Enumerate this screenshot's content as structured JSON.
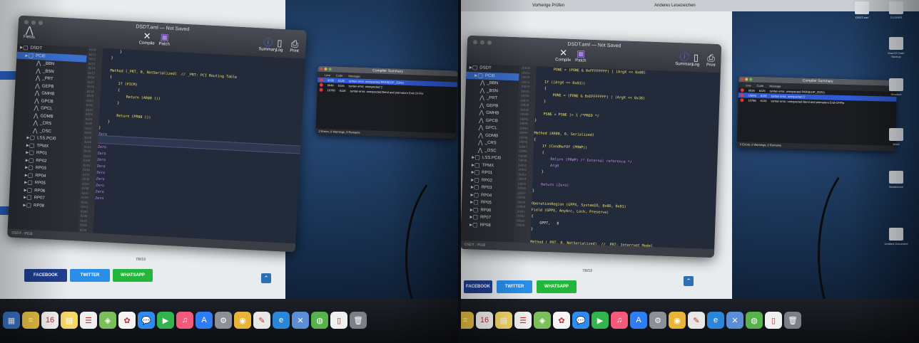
{
  "left_photo": {
    "window_title": "DSDT.aml — Not Saved",
    "toolbar": {
      "fields_label": "Fields",
      "compile_label": "Compile",
      "patch_label": "Patch",
      "summary_label": "Summary",
      "log_label": "Log",
      "print_label": "Print"
    },
    "tree": [
      {
        "label": "DSDT",
        "indent": 0,
        "icon": "folder-icon"
      },
      {
        "label": "PCI0",
        "indent": 1,
        "icon": "folder-icon",
        "selected": true
      },
      {
        "label": "_BBN",
        "indent": 3,
        "icon": "method-icon"
      },
      {
        "label": "_BSN",
        "indent": 3,
        "icon": "method-icon"
      },
      {
        "label": "_PRT",
        "indent": 3,
        "icon": "method-icon"
      },
      {
        "label": "GEPB",
        "indent": 3,
        "icon": "method-icon"
      },
      {
        "label": "GMHB",
        "indent": 3,
        "icon": "method-icon"
      },
      {
        "label": "GPCB",
        "indent": 3,
        "icon": "method-icon"
      },
      {
        "label": "GPCL",
        "indent": 3,
        "icon": "method-icon"
      },
      {
        "label": "GDMB",
        "indent": 3,
        "icon": "method-icon"
      },
      {
        "label": "_CRS",
        "indent": 3,
        "icon": "method-icon"
      },
      {
        "label": "_OSC",
        "indent": 3,
        "icon": "method-icon"
      },
      {
        "label": "LSS.PCI0",
        "indent": 2,
        "icon": "folder-icon"
      },
      {
        "label": "TPMX",
        "indent": 2,
        "icon": "folder-icon"
      },
      {
        "label": "RP01",
        "indent": 2,
        "icon": "folder-icon"
      },
      {
        "label": "RP02",
        "indent": 2,
        "icon": "folder-icon"
      },
      {
        "label": "RP03",
        "indent": 2,
        "icon": "folder-icon"
      },
      {
        "label": "RP04",
        "indent": 2,
        "icon": "folder-icon"
      },
      {
        "label": "RP05",
        "indent": 2,
        "icon": "folder-icon"
      },
      {
        "label": "RP06",
        "indent": 2,
        "icon": "folder-icon"
      },
      {
        "label": "RP07",
        "indent": 2,
        "icon": "folder-icon"
      },
      {
        "label": "RP08",
        "indent": 2,
        "icon": "folder-icon"
      }
    ],
    "gutter_numbers": [
      "6210",
      "6211",
      "6212",
      "6213",
      "6214",
      "6215",
      "6216",
      "6217",
      "6218",
      "6219",
      "6220",
      "6221",
      "6222",
      "6223",
      "6224",
      "6225",
      "6226",
      "6227",
      "6228",
      "6229",
      "6230",
      "6231",
      "6232",
      "6233",
      "6234",
      "6235",
      "6236",
      "6237",
      "6238",
      "6239",
      "6240",
      "6241",
      "6242",
      "6243",
      "6244",
      "6245",
      "6246",
      "6247",
      "6248",
      "6249",
      "6250"
    ],
    "code_lines": [
      {
        "text": "        }",
        "cls": ""
      },
      {
        "text": "    }",
        "cls": ""
      },
      {
        "text": "",
        "cls": ""
      },
      {
        "text": "    Method (_PRT, 0, NotSerialized)  // _PRT: PCI Routing Table",
        "cls": "kw"
      },
      {
        "text": "    {",
        "cls": ""
      },
      {
        "text": "        If (PICM)",
        "cls": "kw"
      },
      {
        "text": "        {",
        "cls": ""
      },
      {
        "text": "            Return (AR00 ())",
        "cls": "kw"
      },
      {
        "text": "        }",
        "cls": ""
      },
      {
        "text": "",
        "cls": ""
      },
      {
        "text": "        Return (PR00 ())",
        "cls": "kw"
      },
      {
        "text": "    }",
        "cls": ""
      },
      {
        "text": "}",
        "cls": ""
      },
      {
        "text": "Zero",
        "cls": "fn"
      },
      {
        "text": "Zero",
        "cls": "fn"
      },
      {
        "text": "Zero",
        "cls": "fn"
      },
      {
        "text": "Zero",
        "cls": "fn"
      },
      {
        "text": "Zero",
        "cls": "fn"
      },
      {
        "text": "Zero",
        "cls": "fn"
      },
      {
        "text": "Zero",
        "cls": "fn"
      },
      {
        "text": "Zero",
        "cls": "fn"
      },
      {
        "text": "Zero",
        "cls": "fn"
      },
      {
        "text": "Zero",
        "cls": "fn"
      },
      {
        "text": "Zero",
        "cls": "fn"
      }
    ],
    "status_label": "DSDT - PCI0",
    "summary": {
      "title": "Compiler Summary",
      "col_line": "Line",
      "col_code": "Code",
      "col_message": "Message",
      "rows": [
        {
          "line": "6036",
          "code": "6126",
          "message": "syntax error, unexpected PARSEOP_ZERO",
          "selected": true
        },
        {
          "line": "6048",
          "code": "6126",
          "message": "syntax error, unexpected '}'"
        },
        {
          "line": "10788",
          "code": "6126",
          "message": "syntax error, unexpected Bend and premature End-Of-File"
        }
      ],
      "footer": "3 Errors, 0 Warnings, 0 Remarks"
    },
    "web": {
      "page_number": "7/8/19",
      "facebook": "FACEBOOK",
      "twitter": "TWITTER",
      "whatsapp": "WHATSAPP"
    },
    "calendar_day": "16"
  },
  "right_photo": {
    "window_title": "DSDT.aml — Not Saved",
    "menubar_text": "Vorherige Prüfen",
    "menubar_right": "Anderes Lesezeichen",
    "toolbar": {
      "compile_label": "Compile",
      "patch_label": "Patch",
      "summary_label": "Summary",
      "log_label": "Log",
      "print_label": "Print"
    },
    "tree": [
      {
        "label": "DSDT",
        "indent": 0,
        "icon": "folder-icon"
      },
      {
        "label": "PCI0",
        "indent": 1,
        "icon": "folder-icon",
        "selected": true
      },
      {
        "label": "_BBN",
        "indent": 2,
        "icon": "method-icon"
      },
      {
        "label": "_BSN",
        "indent": 2,
        "icon": "method-icon"
      },
      {
        "label": "_PRT",
        "indent": 2,
        "icon": "method-icon"
      },
      {
        "label": "GEPB",
        "indent": 2,
        "icon": "method-icon"
      },
      {
        "label": "GMHB",
        "indent": 2,
        "icon": "method-icon"
      },
      {
        "label": "GPCB",
        "indent": 2,
        "icon": "method-icon"
      },
      {
        "label": "GPCL",
        "indent": 2,
        "icon": "method-icon"
      },
      {
        "label": "GDMB",
        "indent": 2,
        "icon": "method-icon"
      },
      {
        "label": "_CRS",
        "indent": 2,
        "icon": "method-icon"
      },
      {
        "label": "_OSC",
        "indent": 2,
        "icon": "method-icon"
      },
      {
        "label": "LSS.PCI0",
        "indent": 1,
        "icon": "folder-icon"
      },
      {
        "label": "TPMX",
        "indent": 1,
        "icon": "folder-icon"
      },
      {
        "label": "RP01",
        "indent": 1,
        "icon": "folder-icon"
      },
      {
        "label": "RP02",
        "indent": 1,
        "icon": "folder-icon"
      },
      {
        "label": "RP03",
        "indent": 1,
        "icon": "folder-icon"
      },
      {
        "label": "RP04",
        "indent": 1,
        "icon": "folder-icon"
      },
      {
        "label": "RP05",
        "indent": 1,
        "icon": "folder-icon"
      },
      {
        "label": "RP06",
        "indent": 1,
        "icon": "folder-icon"
      },
      {
        "label": "RP07",
        "indent": 1,
        "icon": "folder-icon"
      },
      {
        "label": "RP08",
        "indent": 1,
        "icon": "folder-icon"
      }
    ],
    "gutter_numbers": [
      "10830",
      "10831",
      "10832",
      "10833",
      "10834",
      "10835",
      "10836",
      "10837",
      "10838",
      "10839",
      "10840",
      "10841",
      "10842",
      "10843",
      "10844",
      "10845",
      "10846",
      "10847",
      "10848",
      "10849",
      "10850",
      "10851",
      "10852",
      "10853",
      "10854",
      "10855",
      "10856",
      "10857",
      "10858",
      "10859",
      "10860",
      "10861",
      "10862",
      "10863",
      "10864"
    ],
    "code_lines": [
      {
        "text": "        PONE = (PONE & 0xFFFFFFFF) | (ArgX << 0x08)",
        "cls": "kw"
      },
      {
        "text": "",
        "cls": ""
      },
      {
        "text": "    If ((ArgX == 0x03))",
        "cls": "kw"
      },
      {
        "text": "    {",
        "cls": ""
      },
      {
        "text": "        PONE = (PONE & 0xEFFFFFFF) | (ArgX << 0x38)",
        "cls": "kw"
      },
      {
        "text": "    }",
        "cls": ""
      },
      {
        "text": "",
        "cls": ""
      },
      {
        "text": "    PSNE = PSNE |= 1 /*PRED */",
        "cls": "kw"
      },
      {
        "text": "}",
        "cls": ""
      },
      {
        "text": "",
        "cls": ""
      },
      {
        "text": "Method (AR00, 0, Serialized)",
        "cls": "kw"
      },
      {
        "text": "{",
        "cls": ""
      },
      {
        "text": "    If (CondRefOf (PRWP))",
        "cls": "kw"
      },
      {
        "text": "    {",
        "cls": ""
      },
      {
        "text": "        Return (PRWP) /* External reference */",
        "cls": "fn"
      },
      {
        "text": "        Arg0",
        "cls": "fn"
      },
      {
        "text": "    }",
        "cls": ""
      },
      {
        "text": "",
        "cls": ""
      },
      {
        "text": "    Return (Zero)",
        "cls": "fn"
      },
      {
        "text": "}",
        "cls": ""
      },
      {
        "text": "",
        "cls": ""
      },
      {
        "text": "OperationRegion (GPPX, SystemIO, 0x0D, 0x01)",
        "cls": "kw"
      },
      {
        "text": "Field (GPPX, AnyAcc, Lock, Preserve)",
        "cls": "kw"
      },
      {
        "text": "{",
        "cls": ""
      },
      {
        "text": "    GPPT,   8",
        "cls": ""
      },
      {
        "text": "}",
        "cls": ""
      },
      {
        "text": "",
        "cls": ""
      },
      {
        "text": "Method (_PRT, 0, NotSerialized)  // _PRT: Interrupt Model",
        "cls": "kw"
      },
      {
        "text": "{",
        "cls": ""
      },
      {
        "text": "    GPRI = Arg0",
        "cls": "str"
      },
      {
        "text": "    PICM = Arg0",
        "cls": "str"
      },
      {
        "text": "}",
        "cls": ""
      },
      {
        "text": "",
        "cls": ""
      },
      {
        "text": "Method (_PIC, 1, NotSerialized)",
        "cls": "kw"
      }
    ],
    "status_label": "DSDT - PCI0",
    "summary": {
      "title": "Compiler Summary",
      "col_line": "Line",
      "col_code": "Code",
      "col_message": "Message",
      "rows": [
        {
          "line": "6036",
          "code": "6126",
          "message": "syntax error, unexpected PARSEOP_ZERO"
        },
        {
          "line": "10848",
          "code": "6126",
          "message": "syntax error, unexpected '}'",
          "selected": true
        },
        {
          "line": "10788",
          "code": "6126",
          "message": "syntax error, unexpected Bend and premature End-Of-File"
        }
      ],
      "footer": "3 Errors, 0 Warnings, 0 Remarks"
    },
    "web": {
      "page_number": "7/8/19",
      "facebook": "FACEBOOK",
      "twitter": "TWITTER",
      "whatsapp": "WHATSAPP"
    },
    "desktop_icons": [
      "DSDT.aml",
      "CLOVER",
      "MacOS Date Backup",
      "Shortcut",
      "Work",
      "Workbench",
      "Untitled Document"
    ],
    "calendar_day": "16"
  },
  "dock_apps": [
    {
      "name": "launchpad-icon",
      "glyph": "▦",
      "color": "#3b72c6"
    },
    {
      "name": "notes-icon",
      "glyph": "≡",
      "color": "#e9c245"
    },
    {
      "name": "calendar-icon",
      "glyph": "16",
      "color": "#f4f4f4"
    },
    {
      "name": "stickies-icon",
      "glyph": "▤",
      "color": "#f5d66a"
    },
    {
      "name": "reminders-icon",
      "glyph": "☰",
      "color": "#efefef"
    },
    {
      "name": "maps-icon",
      "glyph": "◈",
      "color": "#7bbf5a"
    },
    {
      "name": "photos-icon",
      "glyph": "✿",
      "color": "#f4f4f4"
    },
    {
      "name": "messages-icon",
      "glyph": "💬",
      "color": "#2e8bf0"
    },
    {
      "name": "facetime-icon",
      "glyph": "▶",
      "color": "#33b44f"
    },
    {
      "name": "music-icon",
      "glyph": "♫",
      "color": "#f45b7a"
    },
    {
      "name": "appstore-icon",
      "glyph": "A",
      "color": "#2f7df5"
    },
    {
      "name": "preferences-icon",
      "glyph": "⚙",
      "color": "#8a8f98"
    },
    {
      "name": "chrome-icon",
      "glyph": "◉",
      "color": "#e8b53a"
    },
    {
      "name": "textedit-icon",
      "glyph": "✎",
      "color": "#e7e7e7"
    },
    {
      "name": "edge-icon",
      "glyph": "e",
      "color": "#2a86d6"
    },
    {
      "name": "xcode-tools-icon",
      "glyph": "✕",
      "color": "#5a8fd8"
    },
    {
      "name": "globe-icon",
      "glyph": "◍",
      "color": "#58b24c"
    },
    {
      "name": "doc-icon",
      "glyph": "▯",
      "color": "#f0f0f0"
    },
    {
      "name": "trash-icon",
      "glyph": "🗑",
      "color": "#7c7f85"
    }
  ]
}
